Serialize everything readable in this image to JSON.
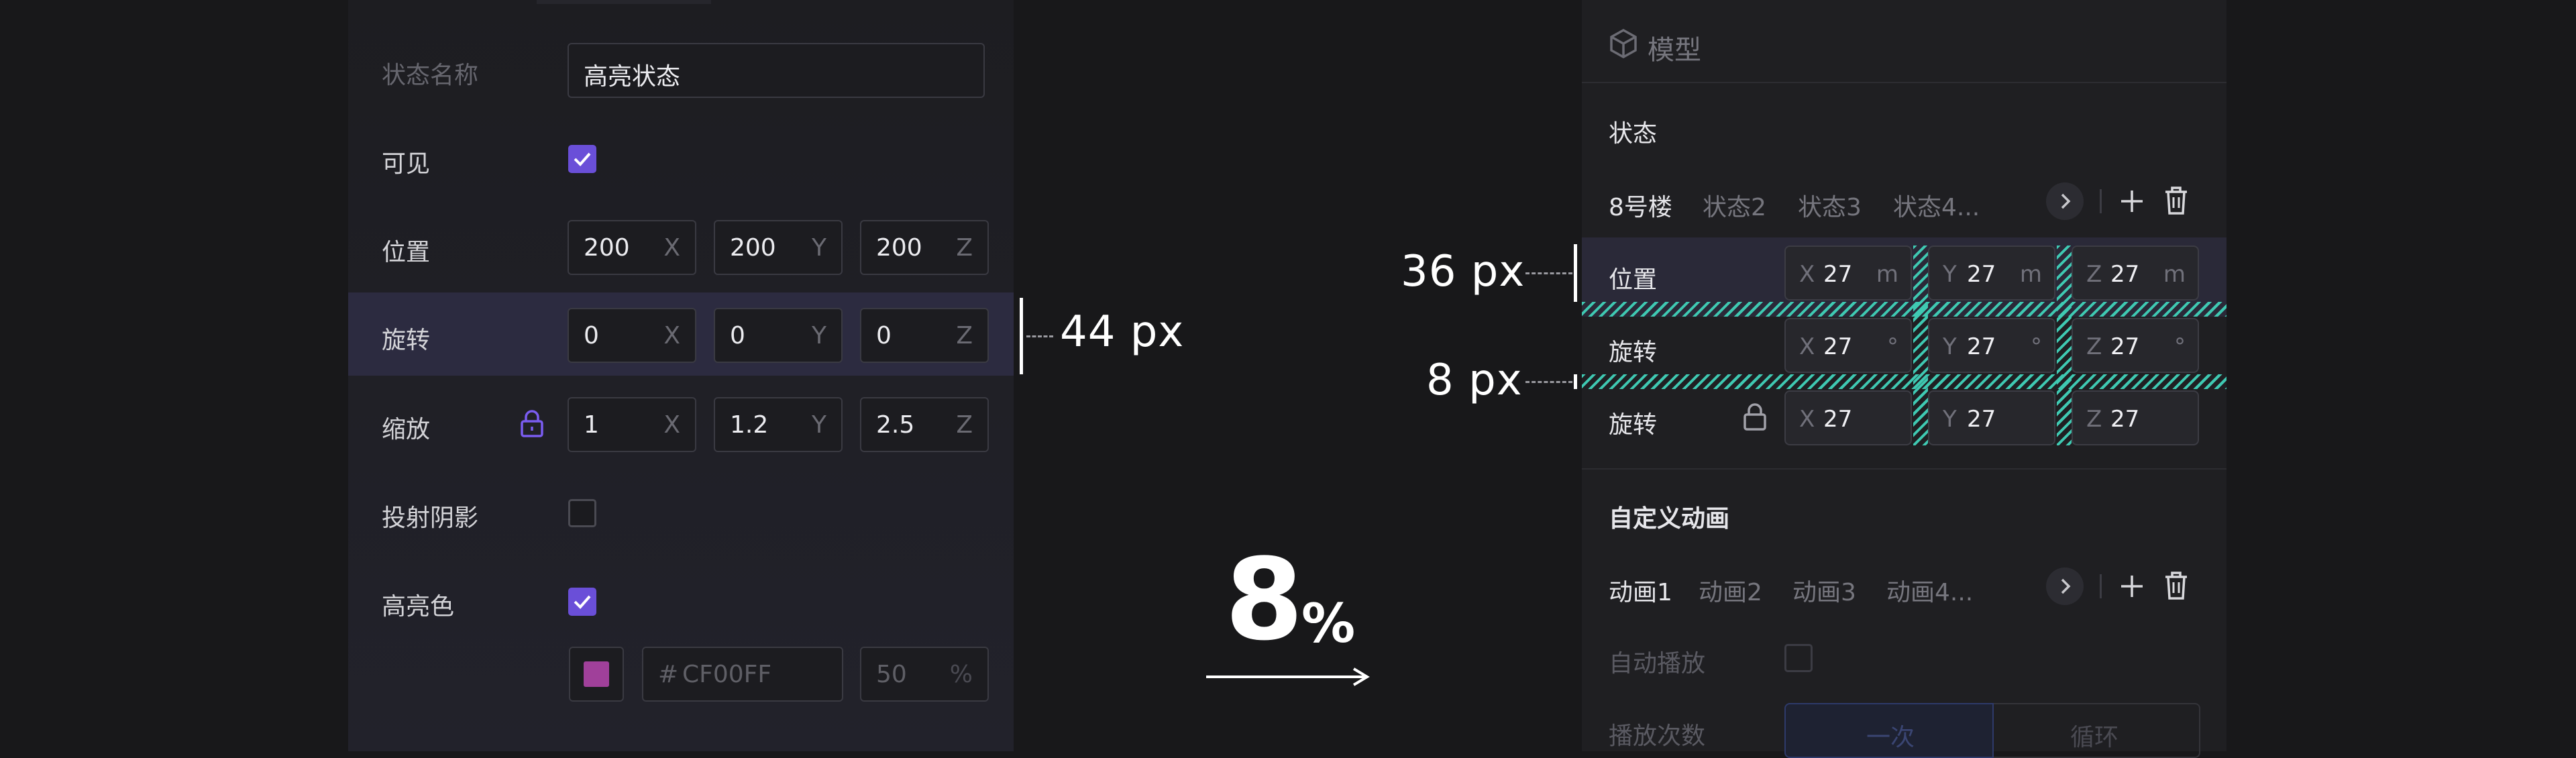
{
  "left_panel": {
    "rows": [
      {
        "label": "状态名称",
        "input_value": "高亮状态"
      },
      {
        "label": "可见",
        "checked": true
      },
      {
        "label": "位置",
        "fields": [
          {
            "value": "200",
            "axis": "X"
          },
          {
            "value": "200",
            "axis": "Y"
          },
          {
            "value": "200",
            "axis": "Z"
          }
        ]
      },
      {
        "label": "旋转",
        "fields": [
          {
            "value": "0",
            "axis": "X"
          },
          {
            "value": "0",
            "axis": "Y"
          },
          {
            "value": "0",
            "axis": "Z"
          }
        ]
      },
      {
        "label": "缩放",
        "fields": [
          {
            "value": "1",
            "axis": "X"
          },
          {
            "value": "1.2",
            "axis": "Y"
          },
          {
            "value": "2.5",
            "axis": "Z"
          }
        ]
      },
      {
        "label": "投射阴影",
        "checked": false
      },
      {
        "label": "高亮色",
        "checked": true
      }
    ],
    "color": {
      "hash": "#",
      "hex": "CF00FF",
      "opacity": "50",
      "unit": "%",
      "swatch": "#a0409a"
    },
    "annotation": "44 px"
  },
  "center": {
    "value": "8",
    "unit": "%"
  },
  "right_panel": {
    "header_title": "模型",
    "section_state": "状态",
    "state_tabs": [
      "8号楼",
      "状态2",
      "状态3",
      "状态4..."
    ],
    "rows": [
      {
        "label": "位置",
        "fields": [
          {
            "axis": "X",
            "value": "27",
            "unit": "m"
          },
          {
            "axis": "Y",
            "value": "27",
            "unit": "m"
          },
          {
            "axis": "Z",
            "value": "27",
            "unit": "m"
          }
        ]
      },
      {
        "label": "旋转",
        "fields": [
          {
            "axis": "X",
            "value": "27",
            "unit": "°"
          },
          {
            "axis": "Y",
            "value": "27",
            "unit": "°"
          },
          {
            "axis": "Z",
            "value": "27",
            "unit": "°"
          }
        ]
      },
      {
        "label": "旋转",
        "fields": [
          {
            "axis": "X",
            "value": "27",
            "unit": ""
          },
          {
            "axis": "Y",
            "value": "27",
            "unit": ""
          },
          {
            "axis": "Z",
            "value": "27",
            "unit": ""
          }
        ]
      }
    ],
    "section_anim": "自定义动画",
    "anim_tabs": [
      "动画1",
      "动画2",
      "动画3",
      "动画4..."
    ],
    "autoplay_label": "自动播放",
    "play_count_label": "播放次数",
    "play_options": [
      "一次",
      "循环"
    ],
    "annotation_row": "36 px",
    "annotation_gap": "8 px",
    "accent": "#3fc9b2"
  }
}
